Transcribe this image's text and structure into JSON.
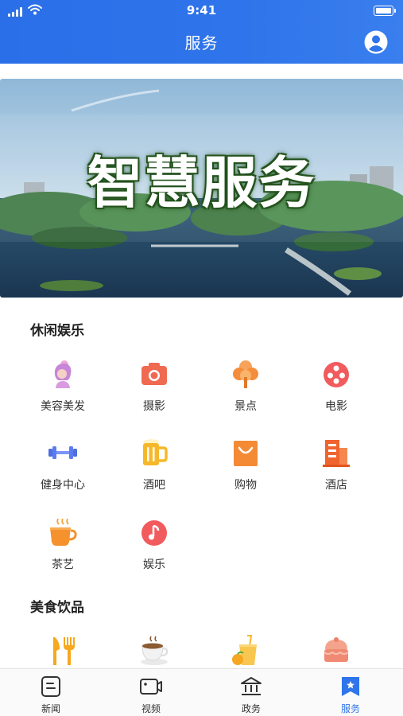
{
  "status_bar": {
    "time": "9:41"
  },
  "header": {
    "title": "服务"
  },
  "banner": {
    "text": "智慧服务"
  },
  "sections": [
    {
      "title": "休闲娱乐",
      "items": [
        {
          "label": "美容美发",
          "icon": "beauty-salon-icon"
        },
        {
          "label": "摄影",
          "icon": "camera-icon"
        },
        {
          "label": "景点",
          "icon": "tree-icon"
        },
        {
          "label": "电影",
          "icon": "film-reel-icon"
        },
        {
          "label": "健身中心",
          "icon": "dumbbell-icon"
        },
        {
          "label": "酒吧",
          "icon": "beer-mug-icon"
        },
        {
          "label": "购物",
          "icon": "shopping-bag-icon"
        },
        {
          "label": "酒店",
          "icon": "hotel-building-icon"
        },
        {
          "label": "茶艺",
          "icon": "tea-cup-icon"
        },
        {
          "label": "娱乐",
          "icon": "music-note-icon"
        }
      ]
    },
    {
      "title": "美食饮品",
      "items": [
        {
          "icon": "fork-knife-icon"
        },
        {
          "icon": "coffee-cup-icon"
        },
        {
          "icon": "juice-icon"
        },
        {
          "icon": "cake-icon"
        }
      ]
    }
  ],
  "tabbar": {
    "items": [
      {
        "label": "新闻",
        "icon": "news-icon",
        "active": false
      },
      {
        "label": "视频",
        "icon": "video-camera-icon",
        "active": false
      },
      {
        "label": "政务",
        "icon": "government-building-icon",
        "active": false
      },
      {
        "label": "服务",
        "icon": "service-bookmark-icon",
        "active": true
      }
    ]
  },
  "colors": {
    "primary": "#2f74ea",
    "tab_active": "#2f74ea",
    "text": "#333333"
  }
}
